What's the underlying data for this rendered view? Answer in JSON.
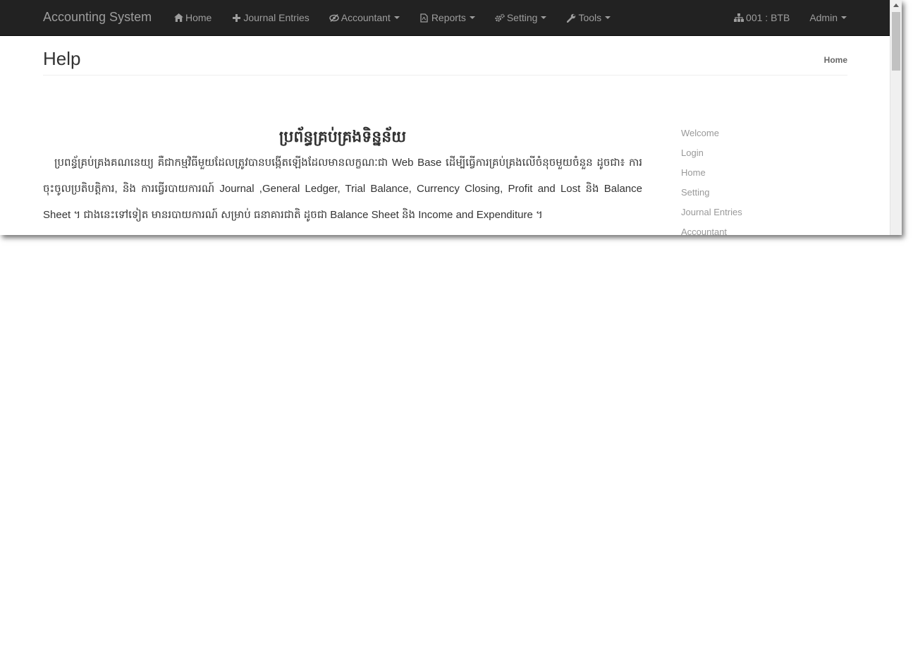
{
  "navbar": {
    "brand": "Accounting System",
    "left_items": [
      {
        "label": "Home",
        "icon": "home-icon",
        "dropdown": false
      },
      {
        "label": "Journal Entries",
        "icon": "plus-icon",
        "dropdown": false
      },
      {
        "label": "Accountant",
        "icon": "eye-slash-icon",
        "dropdown": true
      },
      {
        "label": "Reports",
        "icon": "file-pdf-icon",
        "dropdown": true
      },
      {
        "label": "Setting",
        "icon": "gears-icon",
        "dropdown": true
      },
      {
        "label": "Tools",
        "icon": "wrench-icon",
        "dropdown": true
      }
    ],
    "right_items": [
      {
        "label": "001 : BTB",
        "icon": "sitemap-icon",
        "dropdown": false
      },
      {
        "label": "Admin",
        "icon": "",
        "dropdown": true
      }
    ]
  },
  "header": {
    "title": "Help",
    "breadcrumb": "Home"
  },
  "content": {
    "title": "ប្រព័ន្ធគ្រប់គ្រងទិន្នន័យ",
    "body": "ប្រពន្ធ័គ្រប់គ្រងគណនេយ្យ គឺជាកម្មវិធីមួយដែលត្រូវបានបង្កើតឡើងដែលមានលក្ខណៈជា Web Base ដើម្បីធ្វើការគ្រប់គ្រងលើចំនុចមួយចំនួន ដូចជា៖ ការចុះចូលប្រតិបត្តិការ, និង ការធ្វើរបាយការណ៍ Journal ,General Ledger, Trial Balance, Currency Closing, Profit and Lost និង Balance Sheet ។ ជាងនេះទៅទៀត មានរបាយការណ៍ សម្រាប់ ធនាគារជាតិ ដូចជា Balance Sheet និង Income and Expenditure ។"
  },
  "sidebar": {
    "items": [
      "Welcome",
      "Login",
      "Home",
      "Setting",
      "Journal Entries",
      "Accountant"
    ]
  },
  "colors": {
    "navbar_bg": "#222222",
    "navbar_text": "#9d9d9d",
    "sidebar_link": "#999999"
  }
}
